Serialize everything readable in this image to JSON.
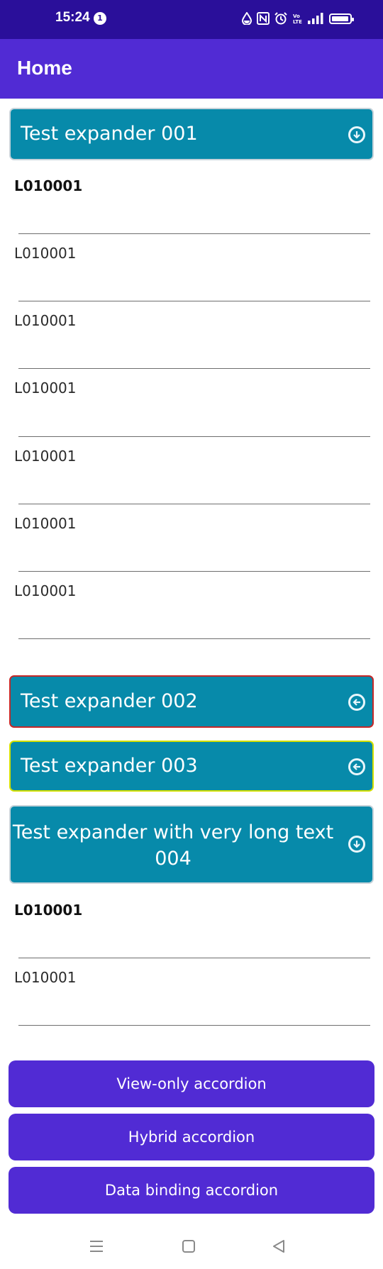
{
  "status_bar": {
    "time": "15:24",
    "notification_count": "1",
    "icons": [
      "data-saver-icon",
      "nfc-icon",
      "alarm-icon",
      "volte-icon",
      "signal-icon",
      "battery-icon"
    ]
  },
  "app_bar": {
    "title": "Home"
  },
  "expanders": [
    {
      "header": "Test expander 001",
      "state": "expanded",
      "icon": "chevron-down-circle-icon",
      "border_color": "#c7d3da",
      "items": [
        "L010001",
        "L010001",
        "L010001",
        "L010001",
        "L010001",
        "L010001",
        "L010001"
      ]
    },
    {
      "header": "Test expander 002",
      "state": "collapsed",
      "icon": "chevron-left-circle-icon",
      "border_color": "#c62828"
    },
    {
      "header": "Test expander 003",
      "state": "collapsed",
      "icon": "chevron-left-circle-icon",
      "border_color": "#d4e000"
    },
    {
      "header": "Test expander with very long text 004",
      "state": "expanded",
      "icon": "chevron-down-circle-icon",
      "border_color": "#c7d3da",
      "items": [
        "L010001",
        "L010001"
      ]
    }
  ],
  "buttons": {
    "view_only": "View-only accordion",
    "hybrid": "Hybrid accordion",
    "data_binding": "Data binding accordion"
  },
  "nav_bar": {
    "icons": [
      "menu-icon",
      "home-square-icon",
      "back-triangle-icon"
    ]
  },
  "colors": {
    "status_bar": "#2a0f9a",
    "app_bar": "#512bd4",
    "expander_header": "#078aaa",
    "button": "#512bd4"
  }
}
